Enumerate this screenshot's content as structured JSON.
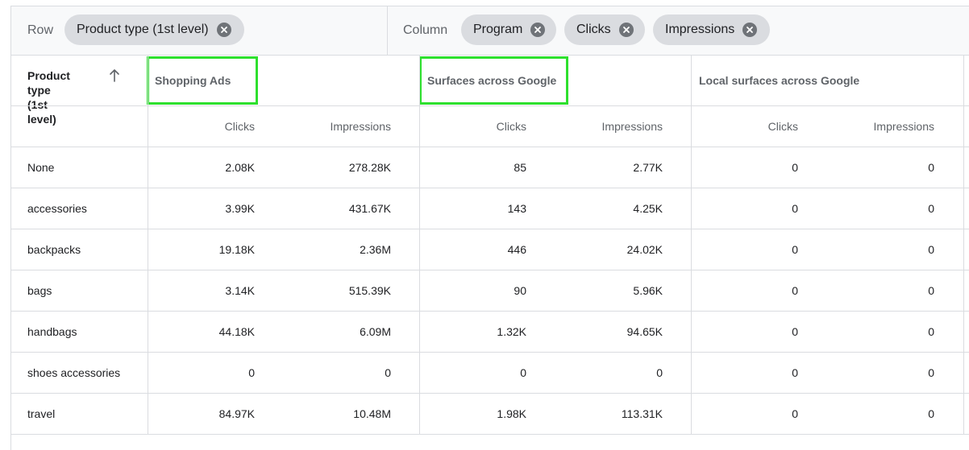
{
  "pivot": {
    "row_label": "Row",
    "column_label": "Column",
    "row_chips": [
      "Product type (1st level)"
    ],
    "column_chips": [
      "Program",
      "Clicks",
      "Impressions"
    ]
  },
  "table": {
    "row_header": "Product type\n(1st level)",
    "groups": [
      "Shopping Ads",
      "Surfaces across Google",
      "Local surfaces across Google"
    ],
    "metrics": [
      "Clicks",
      "Impressions"
    ],
    "rows": [
      {
        "label": "None",
        "values": [
          "2.08K",
          "278.28K",
          "85",
          "2.77K",
          "0",
          "0"
        ]
      },
      {
        "label": "accessories",
        "values": [
          "3.99K",
          "431.67K",
          "143",
          "4.25K",
          "0",
          "0"
        ]
      },
      {
        "label": "backpacks",
        "values": [
          "19.18K",
          "2.36M",
          "446",
          "24.02K",
          "0",
          "0"
        ]
      },
      {
        "label": "bags",
        "values": [
          "3.14K",
          "515.39K",
          "90",
          "5.96K",
          "0",
          "0"
        ]
      },
      {
        "label": "handbags",
        "values": [
          "44.18K",
          "6.09M",
          "1.32K",
          "94.65K",
          "0",
          "0"
        ]
      },
      {
        "label": "shoes accessories",
        "values": [
          "0",
          "0",
          "0",
          "0",
          "0",
          "0"
        ]
      },
      {
        "label": "travel",
        "values": [
          "84.97K",
          "10.48M",
          "1.98K",
          "113.31K",
          "0",
          "0"
        ]
      }
    ]
  },
  "highlight_color": "#2ee02e",
  "icons": {
    "chip_remove": "close-circle-icon",
    "sort": "arrow-up-icon"
  }
}
